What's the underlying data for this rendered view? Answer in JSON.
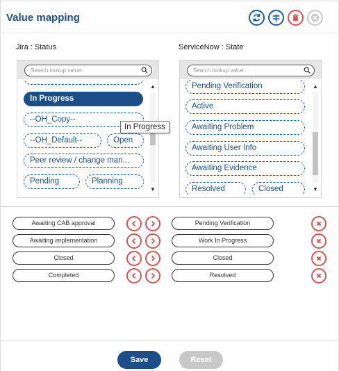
{
  "dialog": {
    "title": "Value mapping",
    "icons": {
      "refresh": "refresh-icon",
      "filter": "filter-icon",
      "delete": "trash-icon",
      "clear": "close-icon"
    }
  },
  "left_column": {
    "label": "Jira : Status",
    "search_placeholder": "Search lookup value..",
    "items": [
      {
        "text": "In Progress",
        "selected": true
      },
      {
        "text": "--OH_Copy--"
      },
      {
        "text": "--OH_Default--"
      },
      {
        "text": "Open"
      },
      {
        "text": "Peer review / change man..."
      },
      {
        "text": "Pending"
      },
      {
        "text": "Planning"
      }
    ],
    "tooltip": "In Progress"
  },
  "right_column": {
    "label": "ServiceNow : State",
    "search_placeholder": "Search lookup value..",
    "items": [
      {
        "text": "Pending Verification"
      },
      {
        "text": "Active"
      },
      {
        "text": "Awaiting Problem"
      },
      {
        "text": "Awaiting User Info"
      },
      {
        "text": "Awaiting Evidence"
      },
      {
        "text": "Resolved"
      },
      {
        "text": "Closed"
      }
    ]
  },
  "mappings": [
    {
      "source": "Awaiting CAB approval",
      "target": "Pending Verification"
    },
    {
      "source": "Awaiting implementation",
      "target": "Work In Progress"
    },
    {
      "source": "Closed",
      "target": "Closed"
    },
    {
      "source": "Completed",
      "target": "Resolved"
    }
  ],
  "footer": {
    "save_label": "Save",
    "reset_label": "Reset"
  },
  "colors": {
    "primary": "#1a4f8c",
    "danger": "#d9534f",
    "disabled": "#c8c8c8"
  }
}
